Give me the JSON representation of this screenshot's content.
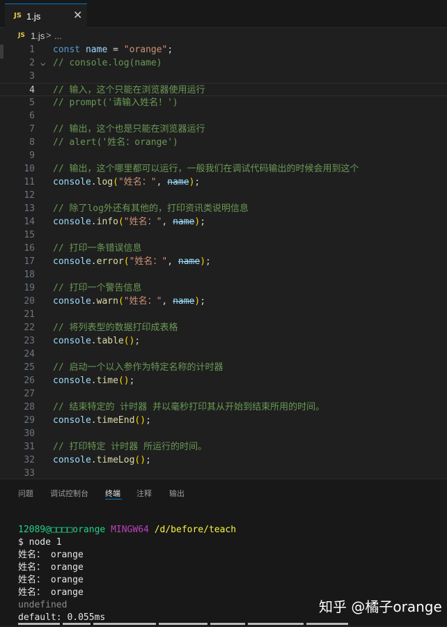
{
  "tab": {
    "icon": "JS",
    "title": "1.js",
    "close": "✕"
  },
  "breadcrumb": {
    "icon": "JS",
    "file": "1.js",
    "sep": ">",
    "more": "..."
  },
  "editor": {
    "lines": [
      {
        "n": "1"
      },
      {
        "n": "2"
      },
      {
        "n": "3"
      },
      {
        "n": "4"
      },
      {
        "n": "5"
      },
      {
        "n": "6"
      },
      {
        "n": "7"
      },
      {
        "n": "8"
      },
      {
        "n": "9"
      },
      {
        "n": "10"
      },
      {
        "n": "11"
      },
      {
        "n": "12"
      },
      {
        "n": "13"
      },
      {
        "n": "14"
      },
      {
        "n": "15"
      },
      {
        "n": "16"
      },
      {
        "n": "17"
      },
      {
        "n": "18"
      },
      {
        "n": "19"
      },
      {
        "n": "20"
      },
      {
        "n": "21"
      },
      {
        "n": "22"
      },
      {
        "n": "23"
      },
      {
        "n": "24"
      },
      {
        "n": "25"
      },
      {
        "n": "26"
      },
      {
        "n": "27"
      },
      {
        "n": "28"
      },
      {
        "n": "29"
      },
      {
        "n": "30"
      },
      {
        "n": "31"
      },
      {
        "n": "32"
      },
      {
        "n": "33"
      }
    ],
    "code": {
      "l1": {
        "kw": "const",
        "var": "name",
        "op": " = ",
        "str": "\"orange\"",
        "end": ";"
      },
      "l2": "// console.log(name)",
      "l4": "// 输入，这个只能在浏览器使用运行",
      "l5": "// prompt('请输入姓名！')",
      "l7": "// 输出，这个也是只能在浏览器运行",
      "l8": "// alert('姓名：orange')",
      "l10": "// 输出，这个哪里都可以运行，一般我们在调试代码输出的时候会用到这个",
      "console": "console",
      "dot": ".",
      "open": "(",
      "close": ")",
      "semi": ";",
      "comma": ", ",
      "str_name": "\"姓名：\"",
      "name": "name",
      "l11_fn": "log",
      "l13": "// 除了log外还有其他的，打印资讯类说明信息",
      "l14_fn": "info",
      "l16": "// 打印一条错误信息",
      "l17_fn": "error",
      "l19": "// 打印一个警告信息",
      "l20_fn": "warn",
      "l22": "// 将列表型的数据打印成表格",
      "l23_fn": "table",
      "l25": "// 启动一个以入参作为特定名称的计时器",
      "l26_fn": "time",
      "l28": "// 结束特定的 计时器 并以毫秒打印其从开始到结束所用的时间。",
      "l29_fn": "timeEnd",
      "l31": "// 打印特定 计时器 所运行的时间。",
      "l32_fn": "timeLog"
    }
  },
  "panel": {
    "tabs": [
      "问题",
      "调试控制台",
      "终端",
      "注释",
      "输出"
    ],
    "active_tab": "终端"
  },
  "terminal": {
    "prompt_user": "12089@□□□□orange",
    "prompt_env": "MINGW64",
    "prompt_path": "/d/before/teach",
    "command": "$ node 1",
    "outputs": [
      "姓名： orange",
      "姓名： orange",
      "姓名： orange",
      "姓名： orange"
    ],
    "undefined": "undefined",
    "timer": "default: 0.055ms"
  },
  "watermark": "知乎 @橘子orange"
}
